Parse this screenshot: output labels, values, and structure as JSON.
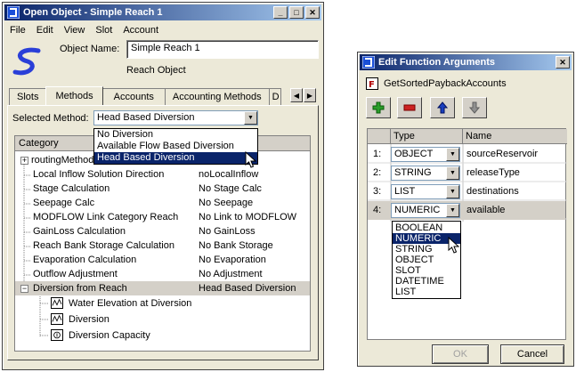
{
  "object_window": {
    "title": "Open Object - Simple Reach 1",
    "menu": [
      "File",
      "Edit",
      "View",
      "Slot",
      "Account"
    ],
    "object_name_label": "Object Name:",
    "object_name_value": "Simple Reach 1",
    "object_type": "Reach Object",
    "tabs": [
      "Slots",
      "Methods",
      "Accounts",
      "Accounting Methods",
      "D"
    ],
    "active_tab": "Methods",
    "selected_method_label": "Selected Method:",
    "selected_method_value": "Head Based Diversion",
    "method_options": [
      "No Diversion",
      "Available Flow Based Diversion",
      "Head Based Diversion"
    ],
    "tree_header": "Category",
    "tree_rows": [
      {
        "category": "routingMethod",
        "value": ""
      },
      {
        "category": "Local Inflow Solution Direction",
        "value": "noLocalInflow"
      },
      {
        "category": "Stage Calculation",
        "value": "No Stage Calc"
      },
      {
        "category": "Seepage Calc",
        "value": "No Seepage"
      },
      {
        "category": "MODFLOW Link Category Reach",
        "value": "No Link to MODFLOW"
      },
      {
        "category": "GainLoss Calculation",
        "value": "No GainLoss"
      },
      {
        "category": "Reach Bank Storage Calculation",
        "value": "No Bank Storage"
      },
      {
        "category": "Evaporation Calculation",
        "value": "No Evaporation"
      },
      {
        "category": "Outflow Adjustment",
        "value": "No Adjustment"
      },
      {
        "category": "Diversion from Reach",
        "value": "Head Based Diversion"
      }
    ],
    "slots": [
      "Water Elevation at Diversion",
      "Diversion",
      "Diversion Capacity"
    ]
  },
  "args_window": {
    "title": "Edit Function Arguments",
    "function_name": "GetSortedPaybackAccounts",
    "columns": [
      "Type",
      "Name"
    ],
    "rows": [
      {
        "num": "1:",
        "type": "OBJECT",
        "name": "sourceReservoir"
      },
      {
        "num": "2:",
        "type": "STRING",
        "name": "releaseType"
      },
      {
        "num": "3:",
        "type": "LIST",
        "name": "destinations"
      },
      {
        "num": "4:",
        "type": "NUMERIC",
        "name": "available"
      }
    ],
    "type_options": [
      "BOOLEAN",
      "NUMERIC",
      "STRING",
      "OBJECT",
      "SLOT",
      "DATETIME",
      "LIST"
    ],
    "selected_type": "NUMERIC",
    "ok_label": "OK",
    "cancel_label": "Cancel"
  },
  "colors": {
    "title_start": "#0a246a",
    "title_end": "#a6caf0",
    "selection": "#0a246a",
    "add": "#2a9d2a",
    "remove": "#cc2222",
    "up": "#1a3fbf"
  },
  "icons": [
    "window-icon",
    "reach-icon",
    "function-icon",
    "plus-icon",
    "minus-icon",
    "arrow-up-icon",
    "arrow-down-icon",
    "cursor-icon"
  ]
}
